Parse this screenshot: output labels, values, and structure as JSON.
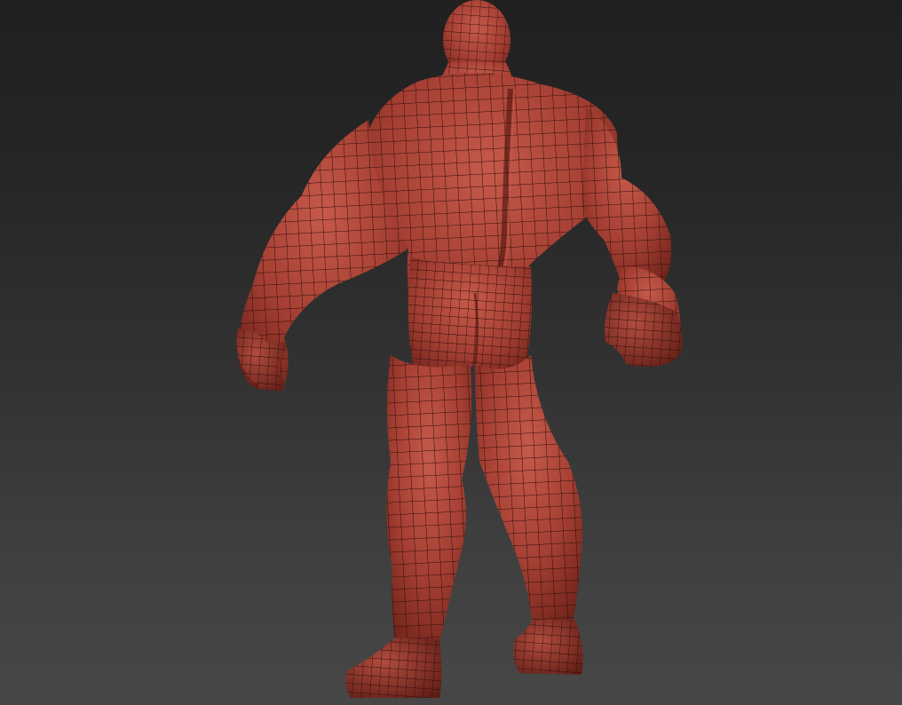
{
  "viewport": {
    "model": "human-figure-back-view",
    "shading": "wireframe-over-material",
    "material_color": "#a23c30",
    "wire_color": "#2a0e0b",
    "background_top": "#202020",
    "background_bottom": "#474747"
  }
}
